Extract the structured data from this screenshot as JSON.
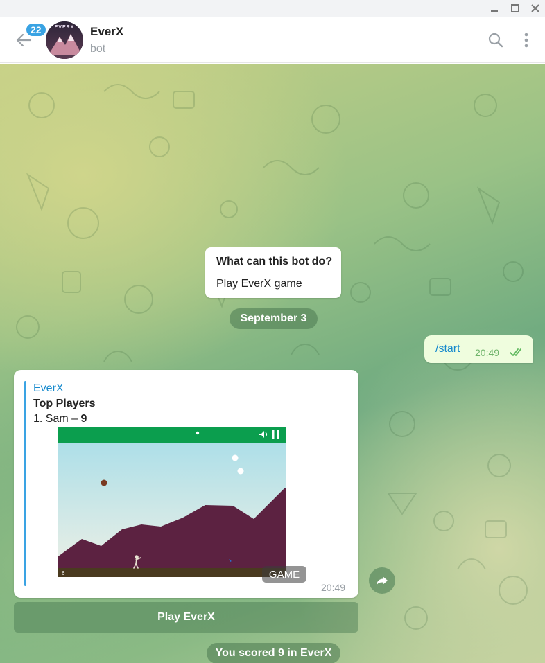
{
  "window": {
    "minimize_icon": "minimize-icon",
    "maximize_icon": "maximize-icon",
    "close_icon": "close-icon"
  },
  "header": {
    "unread_count": "22",
    "avatar_text": "EVERX",
    "title": "EverX",
    "subtitle": "bot",
    "back_icon": "arrow-left-icon",
    "search_icon": "search-icon",
    "menu_icon": "more-vertical-icon"
  },
  "chat": {
    "bot_info": {
      "title": "What can this bot do?",
      "text": "Play EverX game"
    },
    "date_separator": "September 3",
    "outgoing": {
      "text": "/start",
      "time": "20:49",
      "status_icon": "double-check-icon"
    },
    "game_message": {
      "bot_name": "EverX",
      "heading": "Top Players",
      "rank_prefix": "1. Sam – ",
      "rank_score": "9",
      "game_score_display": "6",
      "badge": "GAME",
      "time": "20:49"
    },
    "share_icon": "share-arrow-icon",
    "inline_button": "Play EverX",
    "service_message": "You scored 9 in EverX"
  },
  "colors": {
    "accent": "#168acd",
    "badge_blue": "#3aa3e3",
    "outgoing_bubble": "#effdde",
    "game_bar": "#0b9e4e",
    "mountains": "#5c2241",
    "ground": "#4a3a1f"
  }
}
